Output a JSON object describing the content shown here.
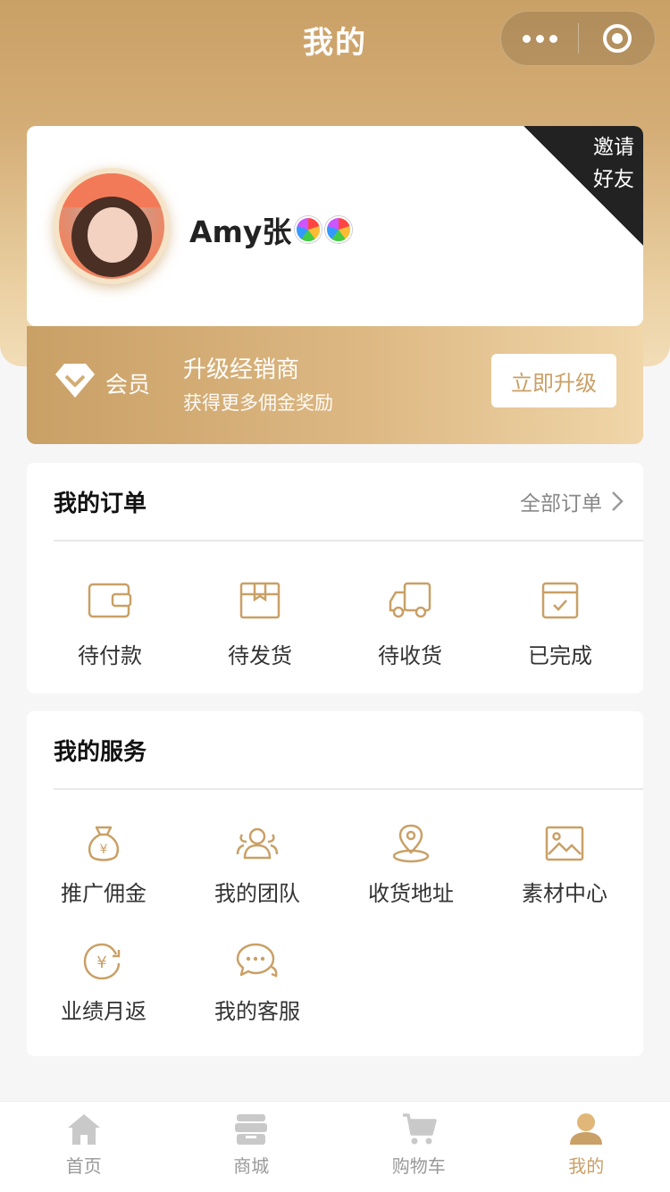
{
  "header": {
    "title": "我的"
  },
  "colors": {
    "accent": "#c9a066",
    "text": "#222222",
    "muted": "#999999"
  },
  "profile": {
    "name": "Amy张",
    "invite_line1": "邀请",
    "invite_line2": "好友"
  },
  "member": {
    "label": "会员",
    "upgrade_title": "升级经销商",
    "upgrade_subtitle": "获得更多佣金奖励",
    "upgrade_button": "立即升级"
  },
  "orders": {
    "title": "我的订单",
    "all_label": "全部订单",
    "items": [
      {
        "label": "待付款",
        "icon": "wallet-icon"
      },
      {
        "label": "待发货",
        "icon": "box-icon"
      },
      {
        "label": "待收货",
        "icon": "truck-icon"
      },
      {
        "label": "已完成",
        "icon": "calendar-check-icon"
      }
    ]
  },
  "services": {
    "title": "我的服务",
    "items": [
      {
        "label": "推广佣金",
        "icon": "money-bag-icon"
      },
      {
        "label": "我的团队",
        "icon": "team-icon"
      },
      {
        "label": "收货地址",
        "icon": "location-pin-icon"
      },
      {
        "label": "素材中心",
        "icon": "image-icon"
      },
      {
        "label": "业绩月返",
        "icon": "yen-refresh-icon"
      },
      {
        "label": "我的客服",
        "icon": "chat-icon"
      }
    ]
  },
  "tabbar": {
    "items": [
      {
        "label": "首页",
        "icon": "home-icon"
      },
      {
        "label": "商城",
        "icon": "store-icon"
      },
      {
        "label": "购物车",
        "icon": "cart-icon"
      },
      {
        "label": "我的",
        "icon": "user-icon",
        "active": true
      }
    ]
  }
}
